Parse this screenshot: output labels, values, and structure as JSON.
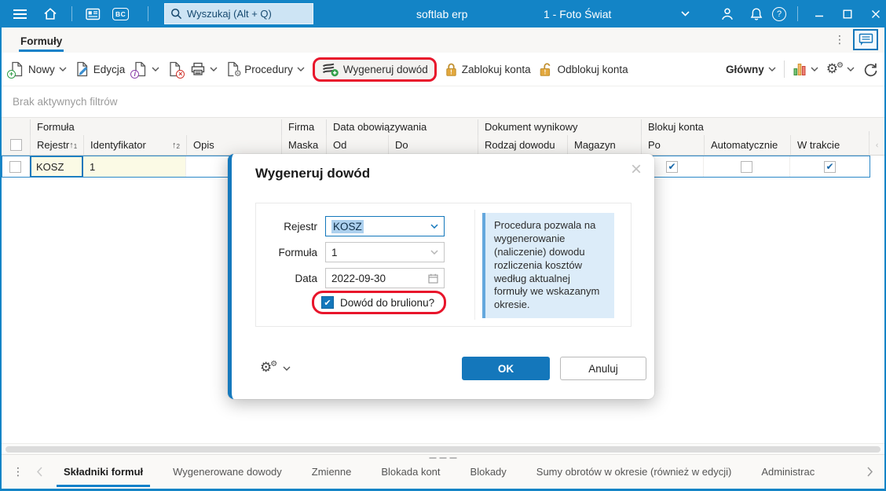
{
  "titlebar": {
    "search_placeholder": "Wyszukaj (Alt + Q)",
    "app_title": "softlab erp",
    "company_selector": "1 - Foto Świat",
    "bc_icon_label": "BC"
  },
  "view_tab": {
    "label": "Formuły"
  },
  "toolbar": {
    "new_label": "Nowy",
    "edit_label": "Edycja",
    "procedures_label": "Procedury",
    "generate_label": "Wygeneruj dowód",
    "lock_accounts_label": "Zablokuj konta",
    "unlock_accounts_label": "Odblokuj konta",
    "layout_label": "Główny"
  },
  "filter_bar": {
    "text": "Brak aktywnych filtrów"
  },
  "grid": {
    "group_headers": [
      "Formuła",
      "Firma",
      "Data obowiązywania",
      "Dokument wynikowy",
      "Blokuj konta"
    ],
    "columns": [
      "Rejestr",
      "Identyfikator",
      "Opis",
      "Maska",
      "Od",
      "Do",
      "Rodzaj dowodu",
      "Magazyn",
      "Po",
      "Automatycznie",
      "W trakcie"
    ],
    "sort_1": "1",
    "sort_2": "2",
    "row": {
      "rejestr": "KOSZ",
      "identyfikator": "1",
      "po_checked": true,
      "automatycznie_checked": false,
      "w_trakcie_checked": true
    }
  },
  "dialog": {
    "title": "Wygeneruj dowód",
    "rejestr_label": "Rejestr",
    "rejestr_value": "KOSZ",
    "formula_label": "Formuła",
    "formula_value": "1",
    "data_label": "Data",
    "data_value": "2022-09-30",
    "draft_checkbox_label": "Dowód do brulionu?",
    "draft_checked": true,
    "info_text": "Procedura pozwala na wygenerowanie (naliczenie) dowodu rozliczenia kosztów według aktualnej formuły we wskazanym okresie.",
    "ok_label": "OK",
    "cancel_label": "Anuluj"
  },
  "footer": {
    "tabs": [
      {
        "label": "Składniki formuł",
        "active": true
      },
      {
        "label": "Wygenerowane dowody",
        "active": false
      },
      {
        "label": "Zmienne",
        "active": false
      },
      {
        "label": "Blokada kont",
        "active": false
      },
      {
        "label": "Blokady",
        "active": false
      },
      {
        "label": "Sumy obrotów w okresie (również w edycji)",
        "active": false
      },
      {
        "label": "Administrac",
        "active": false
      }
    ]
  },
  "colors": {
    "titlebar_blue": "#1384c6",
    "accent_blue": "#1377bb",
    "annotation_red": "#e8152b",
    "selected_cell_yellow": "#fbfae5",
    "info_panel_blue": "#dcecf9",
    "lock_gold": "#e3a83d"
  }
}
